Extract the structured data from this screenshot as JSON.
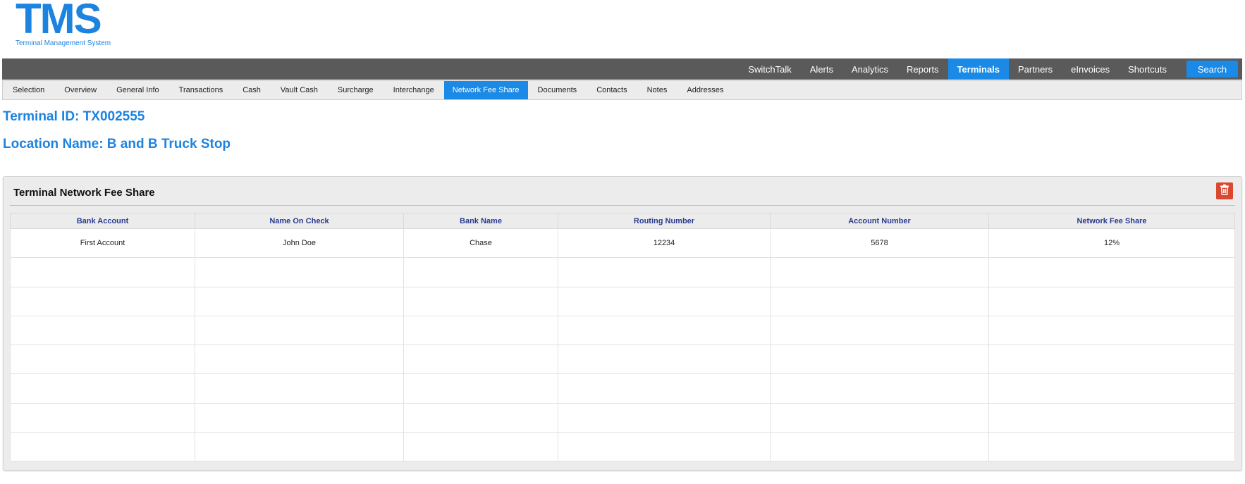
{
  "logo": {
    "mark": "TMS",
    "subtitle": "Terminal Management System"
  },
  "topnav": {
    "items": [
      {
        "label": "SwitchTalk",
        "active": false
      },
      {
        "label": "Alerts",
        "active": false
      },
      {
        "label": "Analytics",
        "active": false
      },
      {
        "label": "Reports",
        "active": false
      },
      {
        "label": "Terminals",
        "active": true
      },
      {
        "label": "Partners",
        "active": false
      },
      {
        "label": "eInvoices",
        "active": false
      },
      {
        "label": "Shortcuts",
        "active": false
      }
    ],
    "search_label": "Search"
  },
  "subnav": {
    "items": [
      {
        "label": "Selection",
        "active": false
      },
      {
        "label": "Overview",
        "active": false
      },
      {
        "label": "General Info",
        "active": false
      },
      {
        "label": "Transactions",
        "active": false
      },
      {
        "label": "Cash",
        "active": false
      },
      {
        "label": "Vault Cash",
        "active": false
      },
      {
        "label": "Surcharge",
        "active": false
      },
      {
        "label": "Interchange",
        "active": false
      },
      {
        "label": "Network Fee Share",
        "active": true
      },
      {
        "label": "Documents",
        "active": false
      },
      {
        "label": "Contacts",
        "active": false
      },
      {
        "label": "Notes",
        "active": false
      },
      {
        "label": "Addresses",
        "active": false
      }
    ]
  },
  "page": {
    "terminal_heading": "Terminal ID: TX002555",
    "location_heading": "Location Name: B and B Truck Stop"
  },
  "panel": {
    "title": "Terminal Network Fee Share",
    "delete_icon": "trash-icon",
    "columns": [
      "Bank Account",
      "Name On Check",
      "Bank Name",
      "Routing Number",
      "Account Number",
      "Network Fee Share"
    ],
    "rows": [
      [
        "First Account",
        "John Doe",
        "Chase",
        "12234",
        "5678",
        "12%"
      ],
      [
        "",
        "",
        "",
        "",
        "",
        ""
      ],
      [
        "",
        "",
        "",
        "",
        "",
        ""
      ],
      [
        "",
        "",
        "",
        "",
        "",
        ""
      ],
      [
        "",
        "",
        "",
        "",
        "",
        ""
      ],
      [
        "",
        "",
        "",
        "",
        "",
        ""
      ],
      [
        "",
        "",
        "",
        "",
        "",
        ""
      ],
      [
        "",
        "",
        "",
        "",
        "",
        ""
      ]
    ]
  },
  "colors": {
    "brand_blue": "#1d83e0",
    "active_tab": "#1a8ae6",
    "topnav_bg": "#5a5a5a",
    "delete_red": "#d9482f",
    "column_header_text": "#2a3b8f"
  }
}
